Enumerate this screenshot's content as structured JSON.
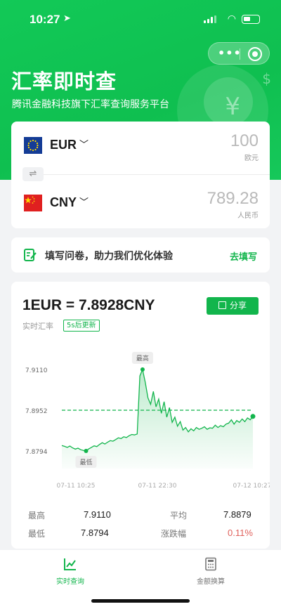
{
  "status_bar": {
    "time": "10:27"
  },
  "header": {
    "title": "汇率即时查",
    "subtitle": "腾讯金融科技旗下汇率查询服务平台"
  },
  "converter": {
    "from": {
      "code": "EUR",
      "amount": "100",
      "unit": "欧元"
    },
    "to": {
      "code": "CNY",
      "amount": "789.28",
      "unit": "人民币"
    },
    "swap_symbol": "⇌"
  },
  "survey": {
    "text": "填写问卷，助力我们优化体验",
    "link": "去填写"
  },
  "rate": {
    "pair": "1EUR = 7.8928CNY",
    "share_label": "分享",
    "live_label": "实时汇率",
    "refresh_badge": "5s后更新"
  },
  "chart_data": {
    "type": "line",
    "y_ticks": [
      "7.9110",
      "7.8952",
      "7.8794"
    ],
    "x_ticks": [
      "07-11 10:25",
      "07-11 22:30",
      "07-12 10:27"
    ],
    "ylim": [
      7.8794,
      7.911
    ],
    "reference_line": 7.8952,
    "high_label": "最高",
    "low_label": "最低",
    "values": [
      7.8815,
      7.8812,
      7.8808,
      7.8813,
      7.8806,
      7.8801,
      7.8805,
      7.8799,
      7.8796,
      7.8794,
      7.8802,
      7.8808,
      7.8814,
      7.8811,
      7.8819,
      7.8826,
      7.8821,
      7.8828,
      7.8834,
      7.8832,
      7.8838,
      7.8845,
      7.8842,
      7.8849,
      7.8846,
      7.8853,
      7.8858,
      7.8856,
      7.886,
      7.9085,
      7.911,
      7.906,
      7.9,
      7.8975,
      7.9025,
      7.8965,
      7.8995,
      7.894,
      7.8985,
      7.8925,
      7.8962,
      7.8905,
      7.8925,
      7.889,
      7.8908,
      7.8875,
      7.8885,
      7.8868,
      7.888,
      7.8872,
      7.8885,
      7.8878,
      7.8882,
      7.8888,
      7.8878,
      7.8884,
      7.8882,
      7.8894,
      7.8885,
      7.8892,
      7.8888,
      7.8898,
      7.8902,
      7.8915,
      7.8898,
      7.8912,
      7.8905,
      7.8918,
      7.8908,
      7.8922,
      7.8915,
      7.8928
    ],
    "line_color": "#12b54c"
  },
  "stats": {
    "high_label": "最高",
    "high_value": "7.9110",
    "avg_label": "平均",
    "avg_value": "7.8879",
    "low_label": "最低",
    "low_value": "7.8794",
    "change_label": "涨跌幅",
    "change_value": "0.11%"
  },
  "tabs": [
    {
      "label": "实时查询",
      "icon": "line-chart-icon",
      "active": true
    },
    {
      "label": "金额换算",
      "icon": "calculator-icon",
      "active": false
    }
  ],
  "colors": {
    "accent": "#12b54c",
    "negative": "#e0605b"
  }
}
